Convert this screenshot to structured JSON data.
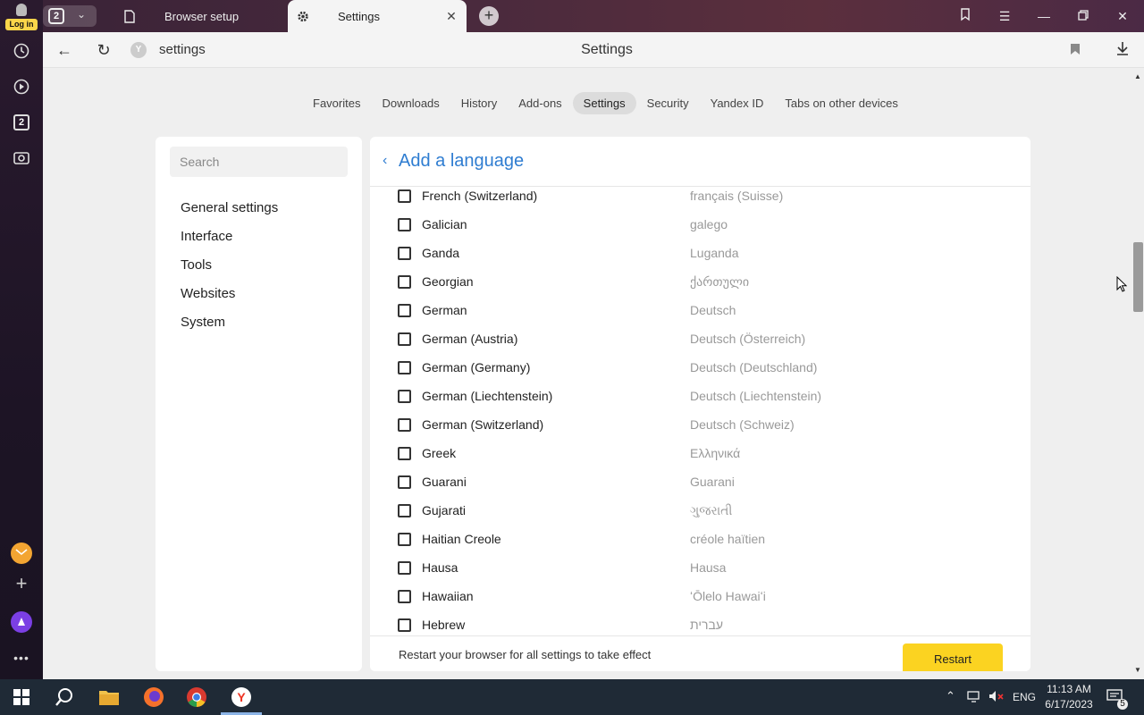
{
  "sidebar_rail": {
    "login_label": "Log in",
    "tab_count": "2",
    "icons": [
      "history-icon",
      "play-icon",
      "tabs-count-icon",
      "screenshot-icon",
      "mail-icon",
      "add-icon",
      "alice-icon",
      "more-icon"
    ],
    "count_badge": "2"
  },
  "tabs": [
    {
      "label": "Browser setup",
      "icon": "page-icon",
      "active": false
    },
    {
      "label": "Settings",
      "icon": "gear-icon",
      "active": true
    }
  ],
  "address_bar": {
    "url": "settings",
    "page_title": "Settings"
  },
  "top_nav": [
    {
      "label": "Favorites",
      "active": false
    },
    {
      "label": "Downloads",
      "active": false
    },
    {
      "label": "History",
      "active": false
    },
    {
      "label": "Add-ons",
      "active": false
    },
    {
      "label": "Settings",
      "active": true
    },
    {
      "label": "Security",
      "active": false
    },
    {
      "label": "Yandex ID",
      "active": false
    },
    {
      "label": "Tabs on other devices",
      "active": false
    }
  ],
  "left_menu": {
    "search_placeholder": "Search",
    "items": [
      "General settings",
      "Interface",
      "Tools",
      "Websites",
      "System"
    ]
  },
  "main": {
    "title": "Add a language",
    "languages": [
      {
        "name": "French (Switzerland)",
        "native": "français (Suisse)",
        "checked": false
      },
      {
        "name": "Galician",
        "native": "galego",
        "checked": false
      },
      {
        "name": "Ganda",
        "native": "Luganda",
        "checked": false
      },
      {
        "name": "Georgian",
        "native": "ქართული",
        "checked": false
      },
      {
        "name": "German",
        "native": "Deutsch",
        "checked": false
      },
      {
        "name": "German (Austria)",
        "native": "Deutsch (Österreich)",
        "checked": false
      },
      {
        "name": "German (Germany)",
        "native": "Deutsch (Deutschland)",
        "checked": false
      },
      {
        "name": "German (Liechtenstein)",
        "native": "Deutsch (Liechtenstein)",
        "checked": false
      },
      {
        "name": "German (Switzerland)",
        "native": "Deutsch (Schweiz)",
        "checked": false
      },
      {
        "name": "Greek",
        "native": "Ελληνικά",
        "checked": false
      },
      {
        "name": "Guarani",
        "native": "Guarani",
        "checked": false
      },
      {
        "name": "Gujarati",
        "native": "ગુજરાતી",
        "checked": false
      },
      {
        "name": "Haitian Creole",
        "native": "créole haïtien",
        "checked": false
      },
      {
        "name": "Hausa",
        "native": "Hausa",
        "checked": false
      },
      {
        "name": "Hawaiian",
        "native": "ʻŌlelo Hawaiʻi",
        "checked": false
      },
      {
        "name": "Hebrew",
        "native": "עברית",
        "checked": false
      }
    ],
    "footer_message": "Restart your browser for all settings to take effect",
    "restart_label": "Restart"
  },
  "taskbar": {
    "apps": [
      "windows-start-icon",
      "search-icon",
      "file-explorer-icon",
      "firefox-icon",
      "chrome-icon",
      "yandex-browser-icon"
    ],
    "language": "ENG",
    "time": "11:13 AM",
    "date": "6/17/2023",
    "notification_count": "5"
  },
  "colors": {
    "accent_blue": "#2f7dd1",
    "restart_yellow": "#fbd321",
    "taskbar": "#1f2a36"
  }
}
